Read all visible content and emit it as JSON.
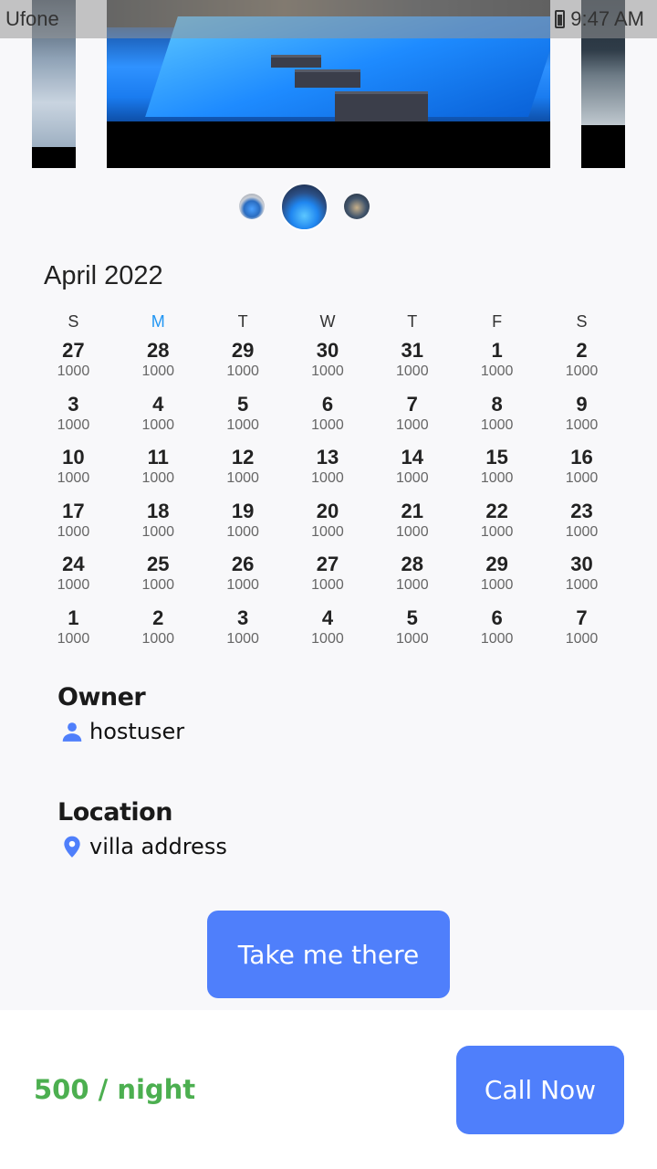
{
  "status_bar": {
    "carrier": "Ufone",
    "time": "9:47 AM"
  },
  "gallery": {
    "slides": [
      "pool-villa-left",
      "pool-villa-main",
      "pool-villa-right"
    ],
    "selected_index": 1
  },
  "calendar": {
    "month": "April 2022",
    "weekdays": [
      "S",
      "M",
      "T",
      "W",
      "T",
      "F",
      "S"
    ],
    "today_weekday_index": 1,
    "today_color": "#2196f3",
    "weeks": [
      [
        {
          "d": "27",
          "p": "1000"
        },
        {
          "d": "28",
          "p": "1000"
        },
        {
          "d": "29",
          "p": "1000"
        },
        {
          "d": "30",
          "p": "1000"
        },
        {
          "d": "31",
          "p": "1000"
        },
        {
          "d": "1",
          "p": "1000"
        },
        {
          "d": "2",
          "p": "1000"
        }
      ],
      [
        {
          "d": "3",
          "p": "1000"
        },
        {
          "d": "4",
          "p": "1000"
        },
        {
          "d": "5",
          "p": "1000"
        },
        {
          "d": "6",
          "p": "1000"
        },
        {
          "d": "7",
          "p": "1000"
        },
        {
          "d": "8",
          "p": "1000"
        },
        {
          "d": "9",
          "p": "1000"
        }
      ],
      [
        {
          "d": "10",
          "p": "1000"
        },
        {
          "d": "11",
          "p": "1000"
        },
        {
          "d": "12",
          "p": "1000"
        },
        {
          "d": "13",
          "p": "1000"
        },
        {
          "d": "14",
          "p": "1000"
        },
        {
          "d": "15",
          "p": "1000"
        },
        {
          "d": "16",
          "p": "1000"
        }
      ],
      [
        {
          "d": "17",
          "p": "1000"
        },
        {
          "d": "18",
          "p": "1000"
        },
        {
          "d": "19",
          "p": "1000"
        },
        {
          "d": "20",
          "p": "1000"
        },
        {
          "d": "21",
          "p": "1000"
        },
        {
          "d": "22",
          "p": "1000"
        },
        {
          "d": "23",
          "p": "1000"
        }
      ],
      [
        {
          "d": "24",
          "p": "1000"
        },
        {
          "d": "25",
          "p": "1000"
        },
        {
          "d": "26",
          "p": "1000"
        },
        {
          "d": "27",
          "p": "1000"
        },
        {
          "d": "28",
          "p": "1000"
        },
        {
          "d": "29",
          "p": "1000"
        },
        {
          "d": "30",
          "p": "1000"
        }
      ],
      [
        {
          "d": "1",
          "p": "1000"
        },
        {
          "d": "2",
          "p": "1000"
        },
        {
          "d": "3",
          "p": "1000"
        },
        {
          "d": "4",
          "p": "1000"
        },
        {
          "d": "5",
          "p": "1000"
        },
        {
          "d": "6",
          "p": "1000"
        },
        {
          "d": "7",
          "p": "1000"
        }
      ]
    ]
  },
  "owner": {
    "title": "Owner",
    "icon": "person-icon",
    "name": "hostuser"
  },
  "location": {
    "title": "Location",
    "icon": "map-pin-icon",
    "address": "villa address"
  },
  "take_me_there_label": "Take me there",
  "bottom_bar": {
    "price": "500 / night",
    "call_label": "Call Now"
  },
  "colors": {
    "accent": "#4f7ffb",
    "price_green": "#4caf50",
    "icon_blue": "#4f7ffb"
  }
}
